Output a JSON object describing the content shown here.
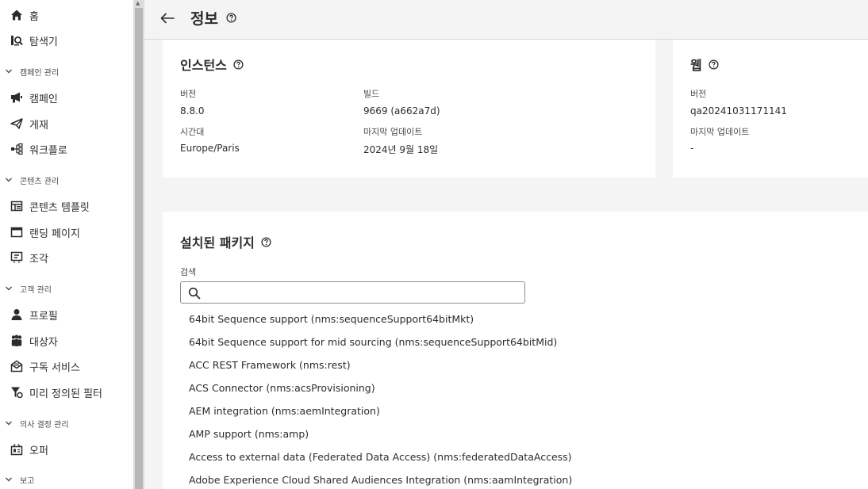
{
  "sidebar": {
    "home": "홈",
    "explorer": "탐색기",
    "sections": {
      "campaign_mgmt": "캠페인 관리",
      "content_mgmt": "콘텐츠 관리",
      "customer_mgmt": "고객 관리",
      "decision_mgmt": "의사 결정 관리",
      "reports": "보고"
    },
    "campaign": "캠페인",
    "deliveries": "게재",
    "workflows": "워크플로",
    "content_templates": "콘텐츠 템플릿",
    "landing_pages": "랜딩 페이지",
    "fragments": "조각",
    "profiles": "프로필",
    "audiences": "대상자",
    "subscription_services": "구독 서비스",
    "predefined_filters": "미리 정의된 필터",
    "offers": "오퍼"
  },
  "header": {
    "title": "정보"
  },
  "instance": {
    "title": "인스턴스",
    "version_label": "버전",
    "version_value": "8.8.0",
    "build_label": "빌드",
    "build_value": "9669 (a662a7d)",
    "timezone_label": "시간대",
    "timezone_value": "Europe/Paris",
    "last_update_label": "마지막 업데이트",
    "last_update_value": "2024년 9월 18일"
  },
  "web": {
    "title": "웹",
    "version_label": "버전",
    "version_value": "qa20241031171141",
    "last_update_label": "마지막 업데이트",
    "last_update_value": "-"
  },
  "packages": {
    "title": "설치된 패키지",
    "search_label": "검색",
    "search_value": "",
    "items": [
      "64bit Sequence support (nms:sequenceSupport64bitMkt)",
      "64bit Sequence support for mid sourcing (nms:sequenceSupport64bitMid)",
      "ACC REST Framework (nms:rest)",
      "ACS Connector (nms:acsProvisioning)",
      "AEM integration (nms:aemIntegration)",
      "AMP support (nms:amp)",
      "Access to external data (Federated Data Access) (nms:federatedDataAccess)",
      "Adobe Experience Cloud Shared Audiences Integration (nms:aamIntegration)"
    ]
  },
  "colors": {
    "background": "#f4f4f4",
    "card": "#ffffff",
    "text": "#2c2c2c",
    "muted": "#4b4b4b"
  }
}
